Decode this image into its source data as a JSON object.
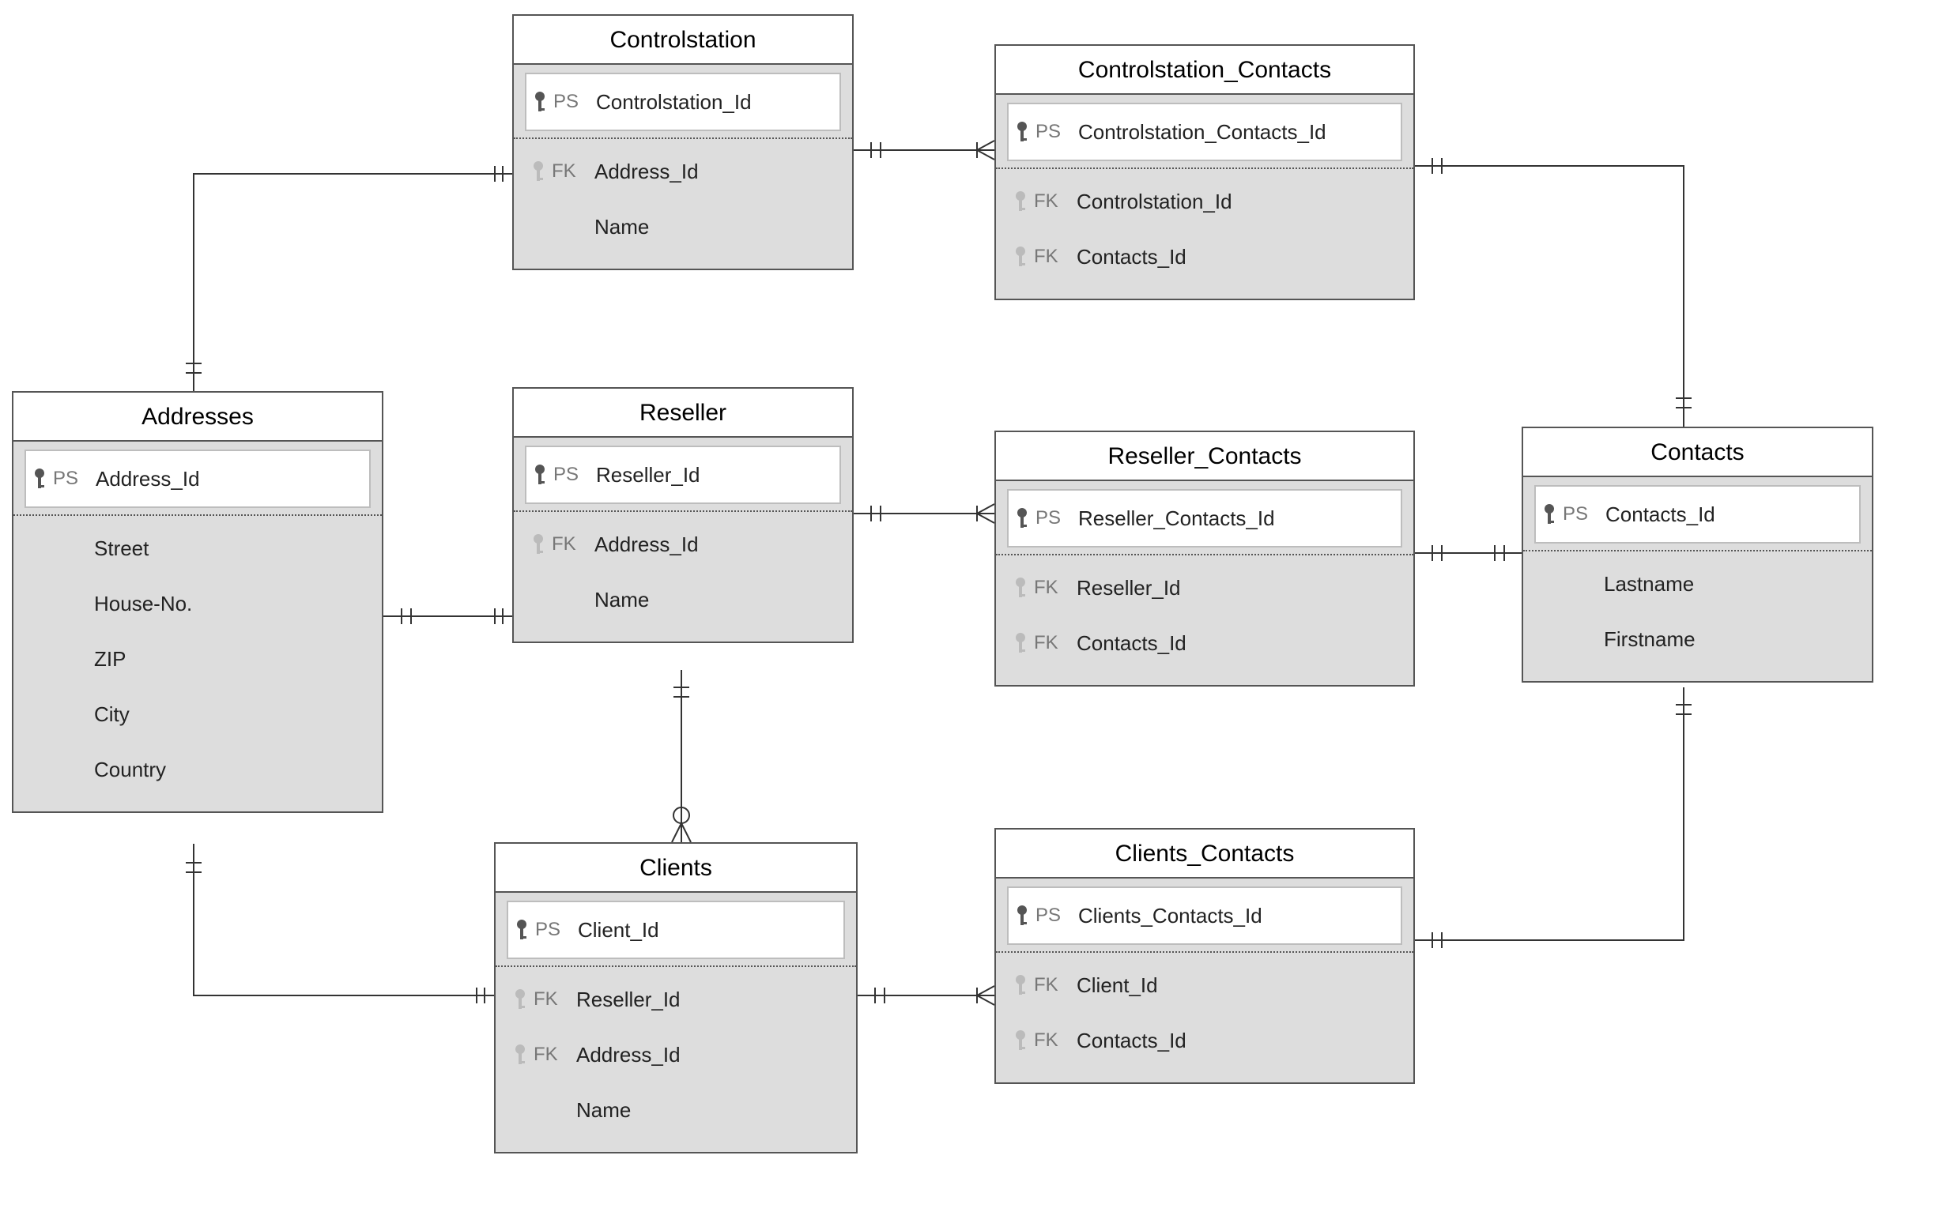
{
  "entities": {
    "addresses": {
      "title": "Addresses",
      "pk": {
        "type": "PS",
        "name": "Address_Id"
      },
      "fields": [
        {
          "type": "",
          "name": "Street"
        },
        {
          "type": "",
          "name": "House-No."
        },
        {
          "type": "",
          "name": "ZIP"
        },
        {
          "type": "",
          "name": "City"
        },
        {
          "type": "",
          "name": "Country"
        }
      ]
    },
    "controlstation": {
      "title": "Controlstation",
      "pk": {
        "type": "PS",
        "name": "Controlstation_Id"
      },
      "fields": [
        {
          "type": "FK",
          "name": "Address_Id"
        },
        {
          "type": "",
          "name": "Name"
        }
      ]
    },
    "reseller": {
      "title": "Reseller",
      "pk": {
        "type": "PS",
        "name": "Reseller_Id"
      },
      "fields": [
        {
          "type": "FK",
          "name": "Address_Id"
        },
        {
          "type": "",
          "name": "Name"
        }
      ]
    },
    "clients": {
      "title": "Clients",
      "pk": {
        "type": "PS",
        "name": "Client_Id"
      },
      "fields": [
        {
          "type": "FK",
          "name": "Reseller_Id"
        },
        {
          "type": "FK",
          "name": "Address_Id"
        },
        {
          "type": "",
          "name": "Name"
        }
      ]
    },
    "controlstation_contacts": {
      "title": "Controlstation_Contacts",
      "pk": {
        "type": "PS",
        "name": "Controlstation_Contacts_Id"
      },
      "fields": [
        {
          "type": "FK",
          "name": "Controlstation_Id"
        },
        {
          "type": "FK",
          "name": "Contacts_Id"
        }
      ]
    },
    "reseller_contacts": {
      "title": "Reseller_Contacts",
      "pk": {
        "type": "PS",
        "name": "Reseller_Contacts_Id"
      },
      "fields": [
        {
          "type": "FK",
          "name": "Reseller_Id"
        },
        {
          "type": "FK",
          "name": "Contacts_Id"
        }
      ]
    },
    "clients_contacts": {
      "title": "Clients_Contacts",
      "pk": {
        "type": "PS",
        "name": "Clients_Contacts_Id"
      },
      "fields": [
        {
          "type": "FK",
          "name": "Client_Id"
        },
        {
          "type": "FK",
          "name": "Contacts_Id"
        }
      ]
    },
    "contacts": {
      "title": "Contacts",
      "pk": {
        "type": "PS",
        "name": "Contacts_Id"
      },
      "fields": [
        {
          "type": "",
          "name": "Lastname"
        },
        {
          "type": "",
          "name": "Firstname"
        }
      ]
    }
  }
}
